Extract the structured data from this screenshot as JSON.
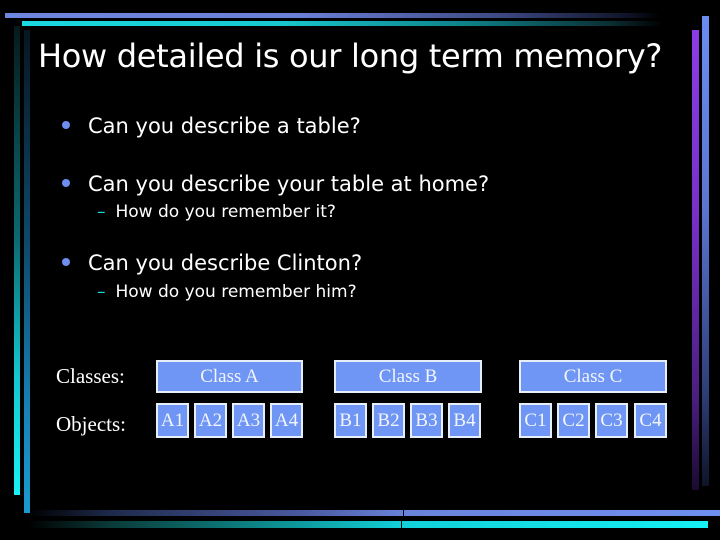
{
  "slide": {
    "title": "How detailed is our long term memory?",
    "bullets": [
      {
        "text": "Can you describe a table?",
        "sub": []
      },
      {
        "text": "Can you describe your table at home?",
        "sub": [
          "How do you remember it?"
        ]
      },
      {
        "text": "Can you describe Clinton?",
        "sub": [
          "How do you remember him?"
        ]
      }
    ],
    "sub_marker": "–",
    "diagram": {
      "classes_label": "Classes:",
      "objects_label": "Objects:",
      "classes": [
        {
          "name": "Class A",
          "objects": [
            "A1",
            "A2",
            "A3",
            "A4"
          ]
        },
        {
          "name": "Class B",
          "objects": [
            "B1",
            "B2",
            "B3",
            "B4"
          ]
        },
        {
          "name": "Class C",
          "objects": [
            "C1",
            "C2",
            "C3",
            "C4"
          ]
        }
      ]
    },
    "colors": {
      "background": "#000000",
      "box_fill": "#6f96f4",
      "box_border": "#e8eef8",
      "bullet": "#6f8ff0",
      "sub_dash": "#1ad8e0"
    }
  }
}
